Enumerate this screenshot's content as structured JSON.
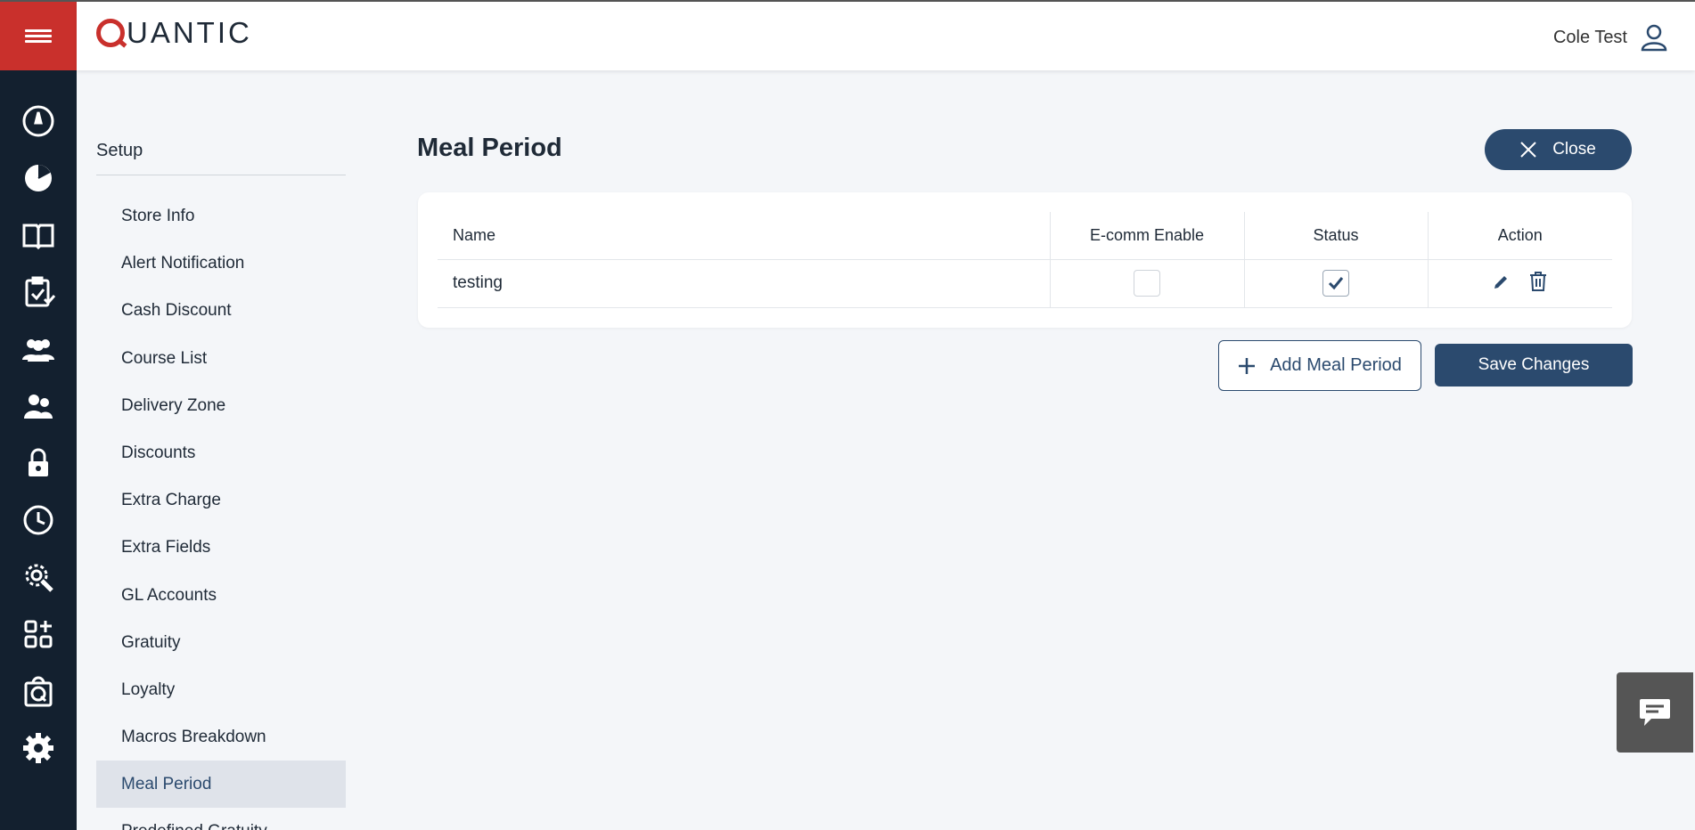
{
  "colors": {
    "brand_red": "#c9302c",
    "rail_bg": "#13202f",
    "primary": "#2b4a6e"
  },
  "rail": {
    "icons": [
      "gauge-icon",
      "pie-chart-icon",
      "book-icon",
      "clipboard-check-icon",
      "people-icon",
      "employees-icon",
      "lock-icon",
      "clock-icon",
      "settings-wrench-icon",
      "apps-add-icon",
      "store-icon",
      "gear-icon"
    ]
  },
  "header": {
    "logo_text": "UANTIC",
    "user_name": "Cole Test"
  },
  "sidebar": {
    "title": "Setup",
    "items": [
      {
        "label": "Store Info"
      },
      {
        "label": "Alert Notification"
      },
      {
        "label": "Cash Discount"
      },
      {
        "label": "Course List"
      },
      {
        "label": "Delivery Zone"
      },
      {
        "label": "Discounts"
      },
      {
        "label": "Extra Charge"
      },
      {
        "label": "Extra Fields"
      },
      {
        "label": "GL Accounts"
      },
      {
        "label": "Gratuity"
      },
      {
        "label": "Loyalty"
      },
      {
        "label": "Macros Breakdown"
      },
      {
        "label": "Meal Period"
      },
      {
        "label": "Predefined Gratuity"
      }
    ],
    "active": "Meal Period"
  },
  "main": {
    "title": "Meal Period",
    "close_label": "Close",
    "table": {
      "columns": [
        "Name",
        "E-comm Enable",
        "Status",
        "Action"
      ],
      "rows": [
        {
          "name": "testing",
          "ecomm_enable": false,
          "status": true
        }
      ]
    },
    "add_label": "Add Meal Period",
    "save_label": "Save Changes"
  }
}
